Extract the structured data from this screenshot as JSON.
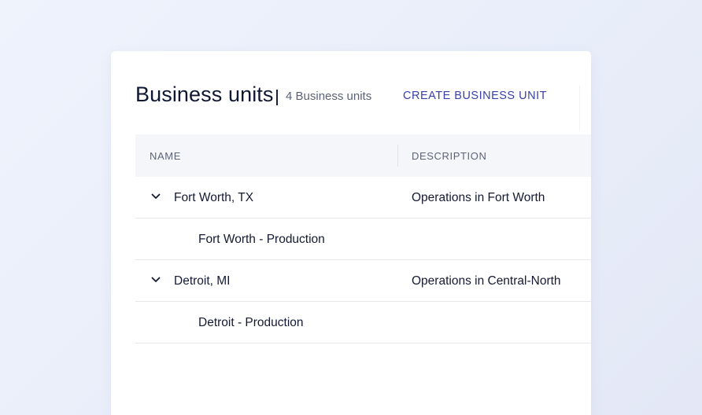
{
  "header": {
    "title": "Business units",
    "count_label": "4 Business units",
    "create_label": "CREATE BUSINESS UNIT"
  },
  "table": {
    "columns": [
      "NAME",
      "DESCRIPTION"
    ],
    "rows": [
      {
        "name": "Fort Worth, TX",
        "description": "Operations in Fort Worth",
        "level": "parent",
        "expanded": true,
        "icon": "chevron-down-icon"
      },
      {
        "name": "Fort Worth - Production",
        "description": "",
        "level": "child"
      },
      {
        "name": "Detroit, MI",
        "description": "Operations in Central-North",
        "level": "parent",
        "expanded": true,
        "icon": "chevron-down-icon"
      },
      {
        "name": "Detroit - Production",
        "description": "",
        "level": "child"
      }
    ]
  },
  "colors": {
    "accent": "#3a41a8",
    "title": "#0f1733",
    "header_bg": "#f5f6fa",
    "background": "#eef2fc"
  }
}
